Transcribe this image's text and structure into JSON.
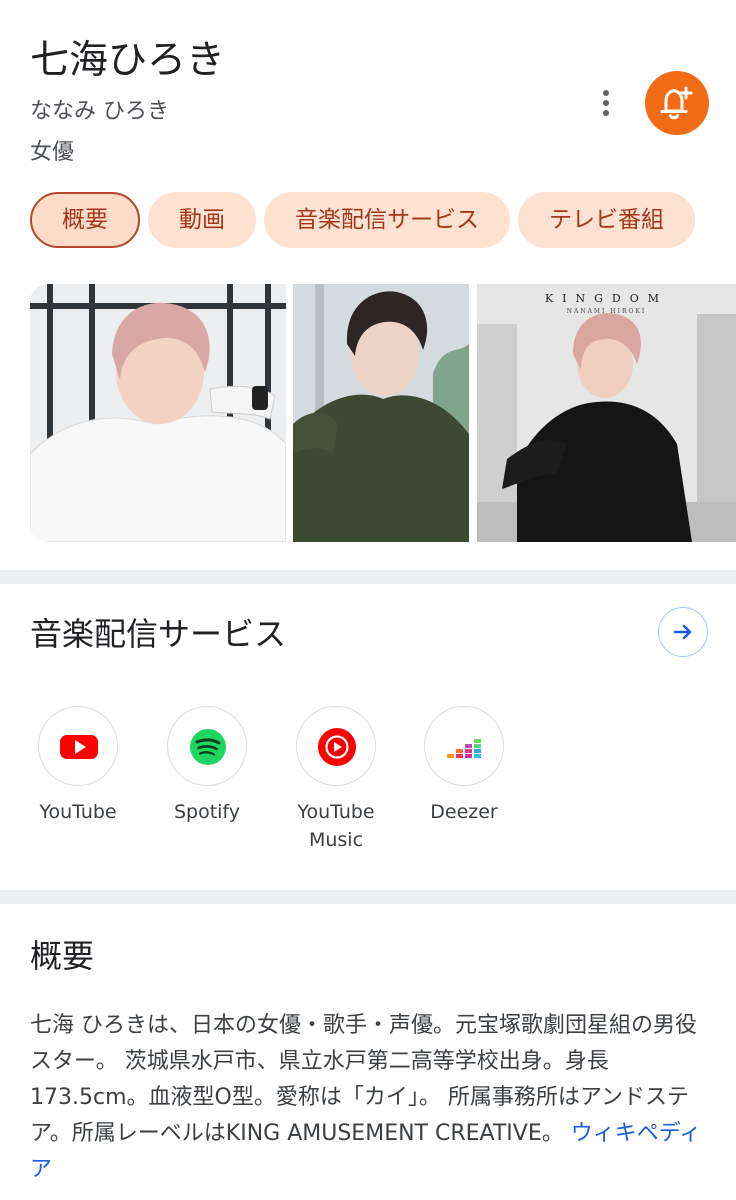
{
  "header": {
    "name": "七海ひろき",
    "reading": "ななみ ひろき",
    "occupation": "女優",
    "more_icon": "more-vert-icon",
    "notify_icon": "bell-plus-icon",
    "accent_color": "#f26b16"
  },
  "tabs": [
    {
      "label": "概要",
      "active": true
    },
    {
      "label": "動画",
      "active": false
    },
    {
      "label": "音楽配信サービス",
      "active": false
    },
    {
      "label": "テレビ番組",
      "active": false
    }
  ],
  "gallery": {
    "album_title": "KINGDOM",
    "album_subtitle": "NANAMI HIROKI"
  },
  "music": {
    "title": "音楽配信サービス",
    "arrow_icon": "arrow-right-icon",
    "services": [
      {
        "name": "YouTube",
        "icon": "youtube-icon",
        "color": "#ff0000"
      },
      {
        "name": "Spotify",
        "icon": "spotify-icon",
        "color": "#1ed760"
      },
      {
        "name": "YouTube\nMusic",
        "icon": "youtube-music-icon",
        "color": "#ff0000"
      },
      {
        "name": "Deezer",
        "icon": "deezer-icon",
        "color": "#a238ff"
      }
    ]
  },
  "overview": {
    "title": "概要",
    "text": "七海 ひろきは、日本の女優・歌手・声優。元宝塚歌劇団星組の男役スター。 茨城県水戸市、県立水戸第二高等学校出身。身長173.5cm。血液型O型。愛称は「カイ」。 所属事務所はアンドステア。所属レーベルはKING AMUSEMENT CREATIVE。",
    "source_link": "ウィキペディア"
  }
}
